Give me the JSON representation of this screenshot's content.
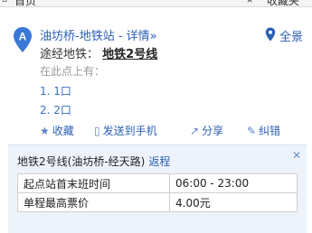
{
  "topbar": {
    "home_label": "首页",
    "fav_label": "收藏夹"
  },
  "station": {
    "marker_letter": "A",
    "name": "油坊桥-地铁站",
    "detail_link": "- 详情»",
    "panorama": "全景",
    "via_label": "途经地铁：",
    "via_line": "地铁2号线",
    "board_label": "在此点上有：",
    "exits": [
      "1. 1口",
      "2. 2口"
    ]
  },
  "actions": [
    {
      "icon": "star-icon",
      "label": "收藏"
    },
    {
      "icon": "phone-icon",
      "label": "发送到手机"
    },
    {
      "icon": "share-icon",
      "label": "分享"
    },
    {
      "icon": "edit-icon",
      "label": "纠错"
    }
  ],
  "route": {
    "title": "地铁2号线(油坊桥-经天路)",
    "back_label": "返程",
    "rows": [
      {
        "key": "起点站首末班时间",
        "value": "06:00 - 23:00"
      },
      {
        "key": "单程最高票价",
        "value": "4.00元"
      }
    ]
  },
  "colors": {
    "link": "#2b5fb3",
    "marker": "#3a78d6",
    "panel_bg": "#eef3fb"
  }
}
